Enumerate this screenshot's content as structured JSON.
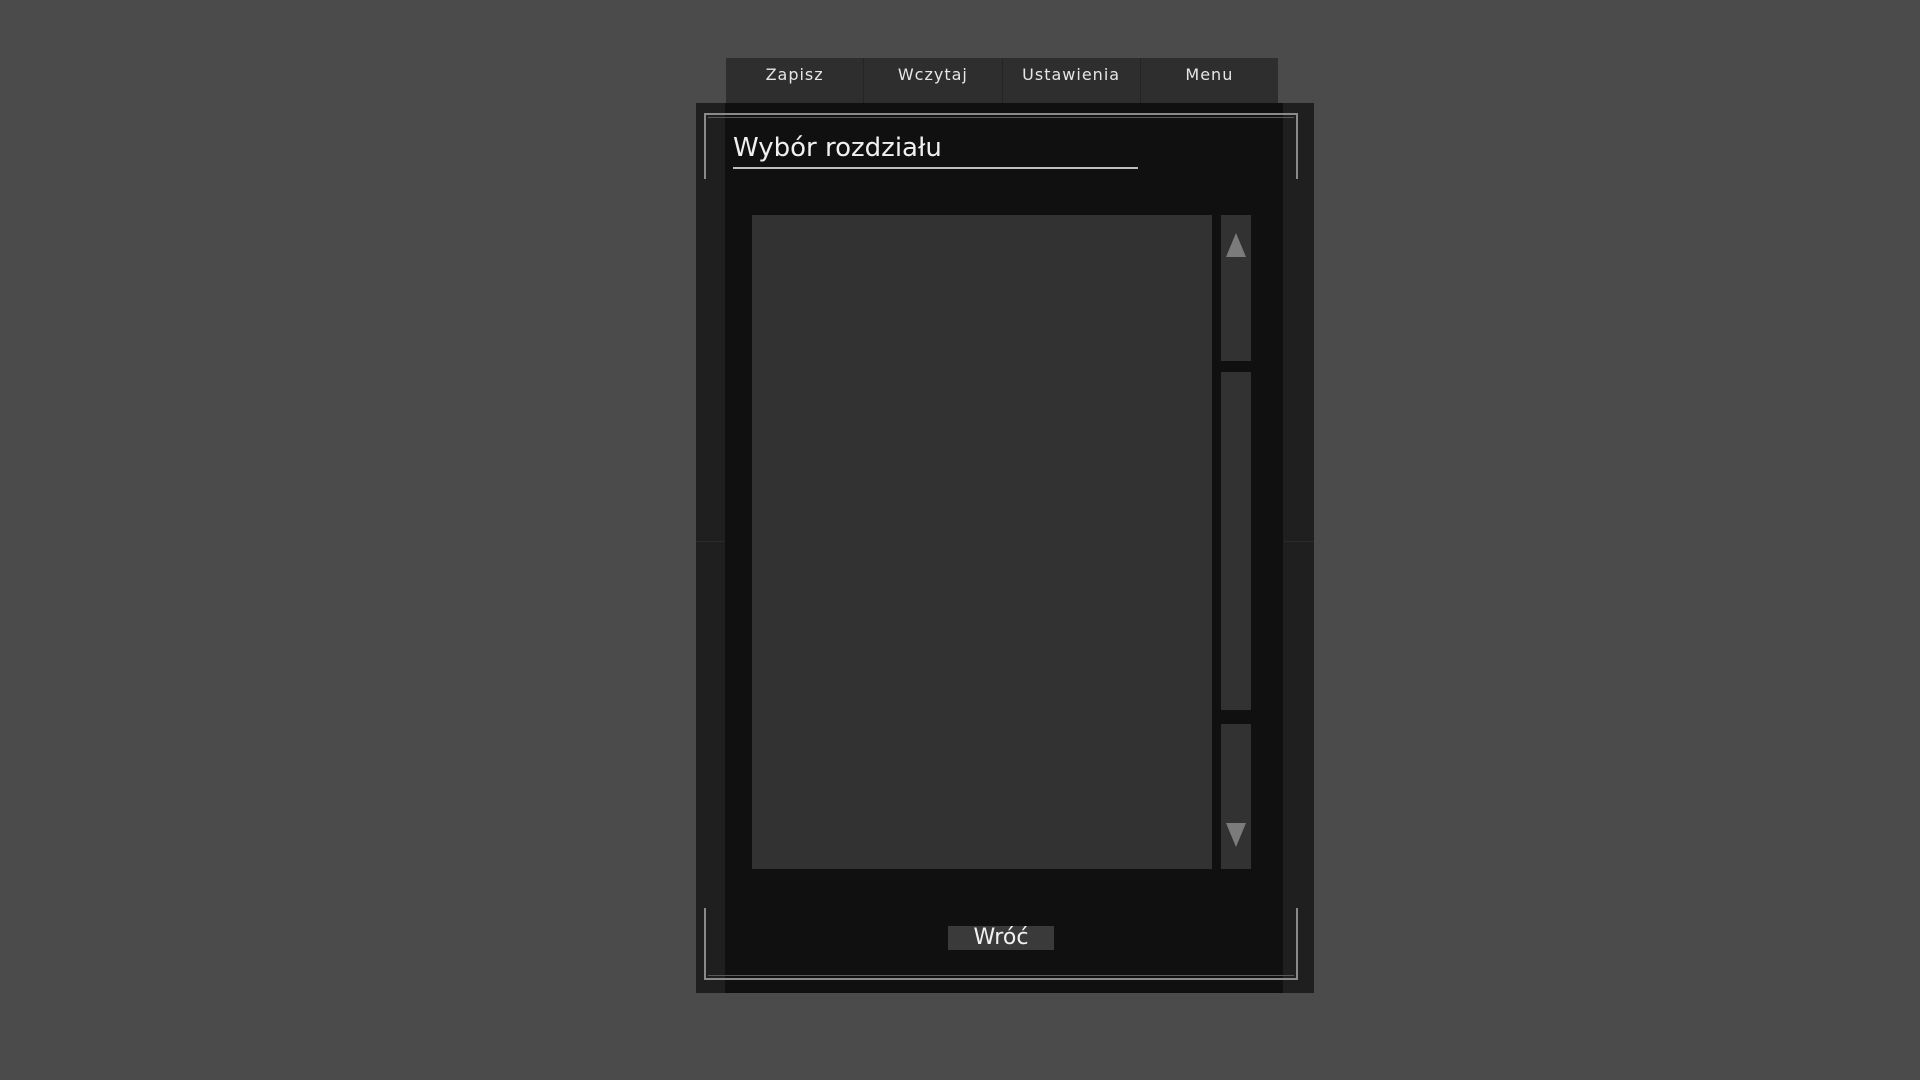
{
  "menu": {
    "items": [
      {
        "label": "Zapisz"
      },
      {
        "label": "Wczytaj"
      },
      {
        "label": "Ustawienia"
      },
      {
        "label": "Menu"
      }
    ]
  },
  "dialog": {
    "title": "Wybór rozdziału",
    "back_label": "Wróć",
    "chapters": []
  },
  "icons": {
    "scroll_up": "triangle-up-icon",
    "scroll_down": "triangle-down-icon"
  },
  "colors": {
    "background": "#4b4b4b",
    "panel": "#1f1f1f",
    "panel_inner": "#101010",
    "list": "#323232",
    "frame": "#8a8a8a",
    "text": "#f0f0f0"
  }
}
